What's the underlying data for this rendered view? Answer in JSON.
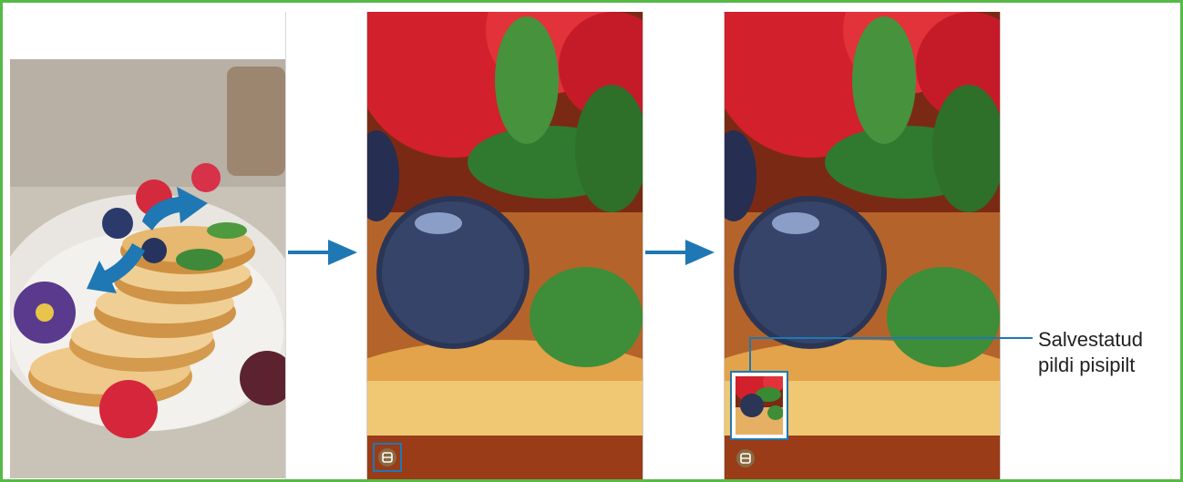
{
  "figure": {
    "border_color": "#57b947",
    "accent_color": "#1f78b4",
    "callout": {
      "line1": "Salvestatud",
      "line2": "pildi pisipilt"
    }
  },
  "screens": [
    {
      "name": "photo-full-view",
      "gesture": "spread-zoom-in"
    },
    {
      "name": "photo-zoomed-in",
      "capture_button": "capture-icon"
    },
    {
      "name": "photo-zoomed-captured",
      "thumbnail": "saved-image-thumbnail"
    }
  ]
}
